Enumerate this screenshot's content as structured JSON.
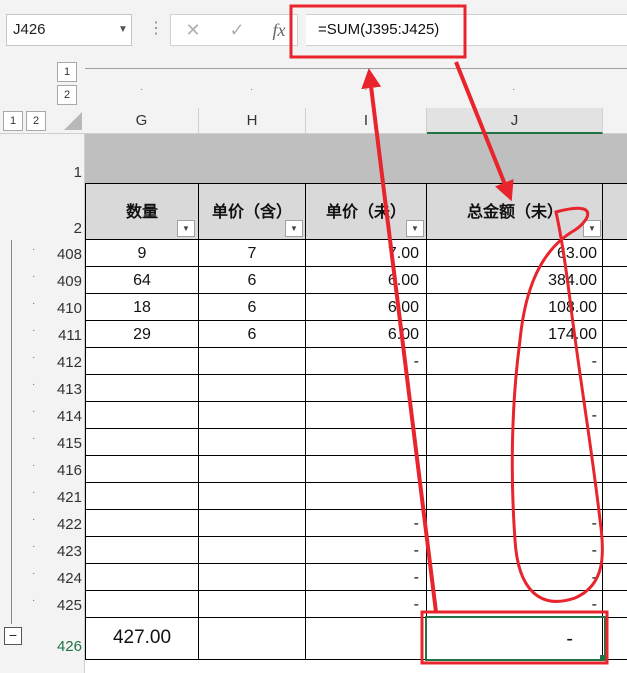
{
  "name_box": "J426",
  "formula": "=SUM(J395:J425)",
  "formula_buttons": [
    "✕",
    "✓",
    "fx"
  ],
  "outline_levels_top": [
    "1",
    "2"
  ],
  "outline_levels_left": [
    "1",
    "2"
  ],
  "columns": [
    "G",
    "H",
    "I",
    "J"
  ],
  "header_row_numbers": [
    "1",
    "2"
  ],
  "headers": {
    "g": "数量",
    "h": "单价（含）",
    "i": "单价（未）",
    "j": "总金额（未）"
  },
  "rows": [
    {
      "num": "408",
      "g": "9",
      "h": "7",
      "i": "7.00",
      "j": "63.00"
    },
    {
      "num": "409",
      "g": "64",
      "h": "6",
      "i": "6.00",
      "j": "384.00"
    },
    {
      "num": "410",
      "g": "18",
      "h": "6",
      "i": "6.00",
      "j": "108.00"
    },
    {
      "num": "411",
      "g": "29",
      "h": "6",
      "i": "6.00",
      "j": "174.00"
    },
    {
      "num": "412",
      "g": "",
      "h": "",
      "i": "-",
      "j": "-"
    },
    {
      "num": "413",
      "g": "",
      "h": "",
      "i": "",
      "j": ""
    },
    {
      "num": "414",
      "g": "",
      "h": "",
      "i": "",
      "j": "-"
    },
    {
      "num": "415",
      "g": "",
      "h": "",
      "i": "",
      "j": ""
    },
    {
      "num": "416",
      "g": "",
      "h": "",
      "i": "",
      "j": ""
    },
    {
      "num": "421",
      "g": "",
      "h": "",
      "i": "",
      "j": ""
    },
    {
      "num": "422",
      "g": "",
      "h": "",
      "i": "-",
      "j": "-"
    },
    {
      "num": "423",
      "g": "",
      "h": "",
      "i": "-",
      "j": "-"
    },
    {
      "num": "424",
      "g": "",
      "h": "",
      "i": "-",
      "j": "-"
    },
    {
      "num": "425",
      "g": "",
      "h": "",
      "i": "-",
      "j": "-"
    }
  ],
  "total_row": {
    "num": "426",
    "g": "427.00",
    "j": "-"
  },
  "collapse_button": "−",
  "colors": {
    "annotation": "#e8242c",
    "selection": "#217346",
    "row1_fill": "#bfbfbf",
    "row2_fill": "#d9d9d9"
  }
}
